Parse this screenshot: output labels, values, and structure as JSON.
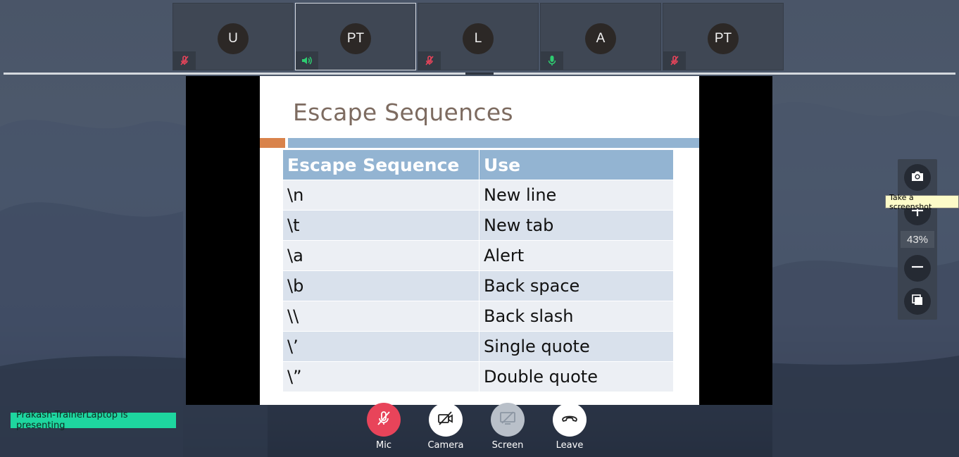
{
  "participants": [
    {
      "initials": "U",
      "mic": "muted",
      "active": false
    },
    {
      "initials": "PT",
      "mic": "speaking",
      "active": true
    },
    {
      "initials": "L",
      "mic": "muted",
      "active": false
    },
    {
      "initials": "A",
      "mic": "on",
      "active": false
    },
    {
      "initials": "PT",
      "mic": "muted",
      "active": false
    }
  ],
  "slide": {
    "title": "Escape Sequences",
    "headers": [
      "Escape Sequence",
      "Use"
    ],
    "rows": [
      [
        "\\n",
        "New line"
      ],
      [
        "\\t",
        "New tab"
      ],
      [
        "\\a",
        "Alert"
      ],
      [
        "\\b",
        "Back space"
      ],
      [
        "\\\\",
        "Back slash"
      ],
      [
        "\\’",
        "Single quote"
      ],
      [
        "\\”",
        "Double quote"
      ]
    ]
  },
  "zoom": {
    "level": "43%",
    "tooltip": "Take a screenshot"
  },
  "presenting_text": "Prakash-TrainerLaptop is presenting",
  "controls": {
    "mic_label": "Mic",
    "camera_label": "Camera",
    "screen_label": "Screen",
    "leave_label": "Leave"
  },
  "colors": {
    "mic_muted": "#e8445a",
    "mic_on": "#2ecc71",
    "speaking": "#2ecc71",
    "presenting_badge": "#1ed69f",
    "table_header": "#93b4d2"
  }
}
